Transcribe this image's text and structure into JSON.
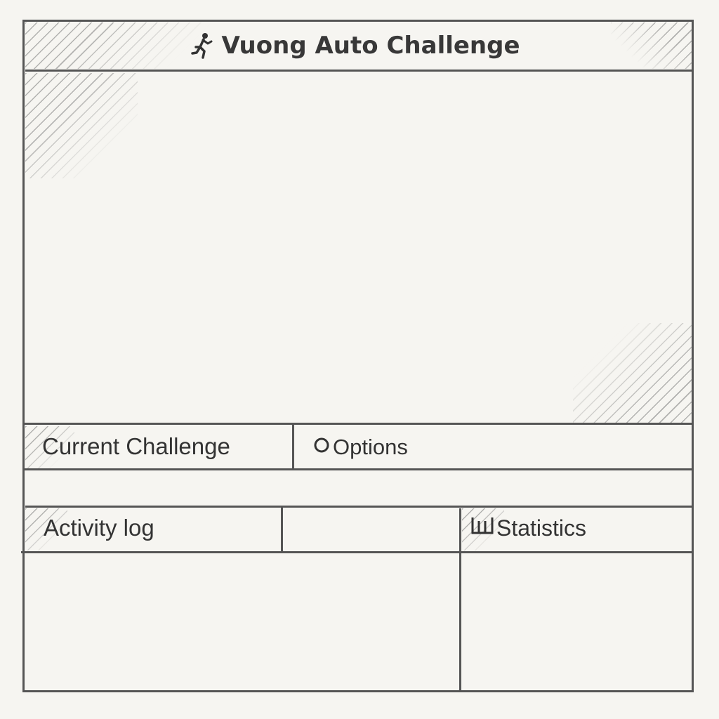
{
  "app": {
    "title": "Vuong Auto Challenge",
    "title_icon": "runner-icon"
  },
  "tabs": {
    "current_challenge": "Current Challenge",
    "options": "Options",
    "options_icon": "circle-icon"
  },
  "panels": {
    "activity_log": "Activity log",
    "statistics": "Statistics",
    "statistics_icon": "bar-chart-icon"
  },
  "colors": {
    "background": "#f6f5f1",
    "line": "#555555",
    "text": "#333333"
  }
}
